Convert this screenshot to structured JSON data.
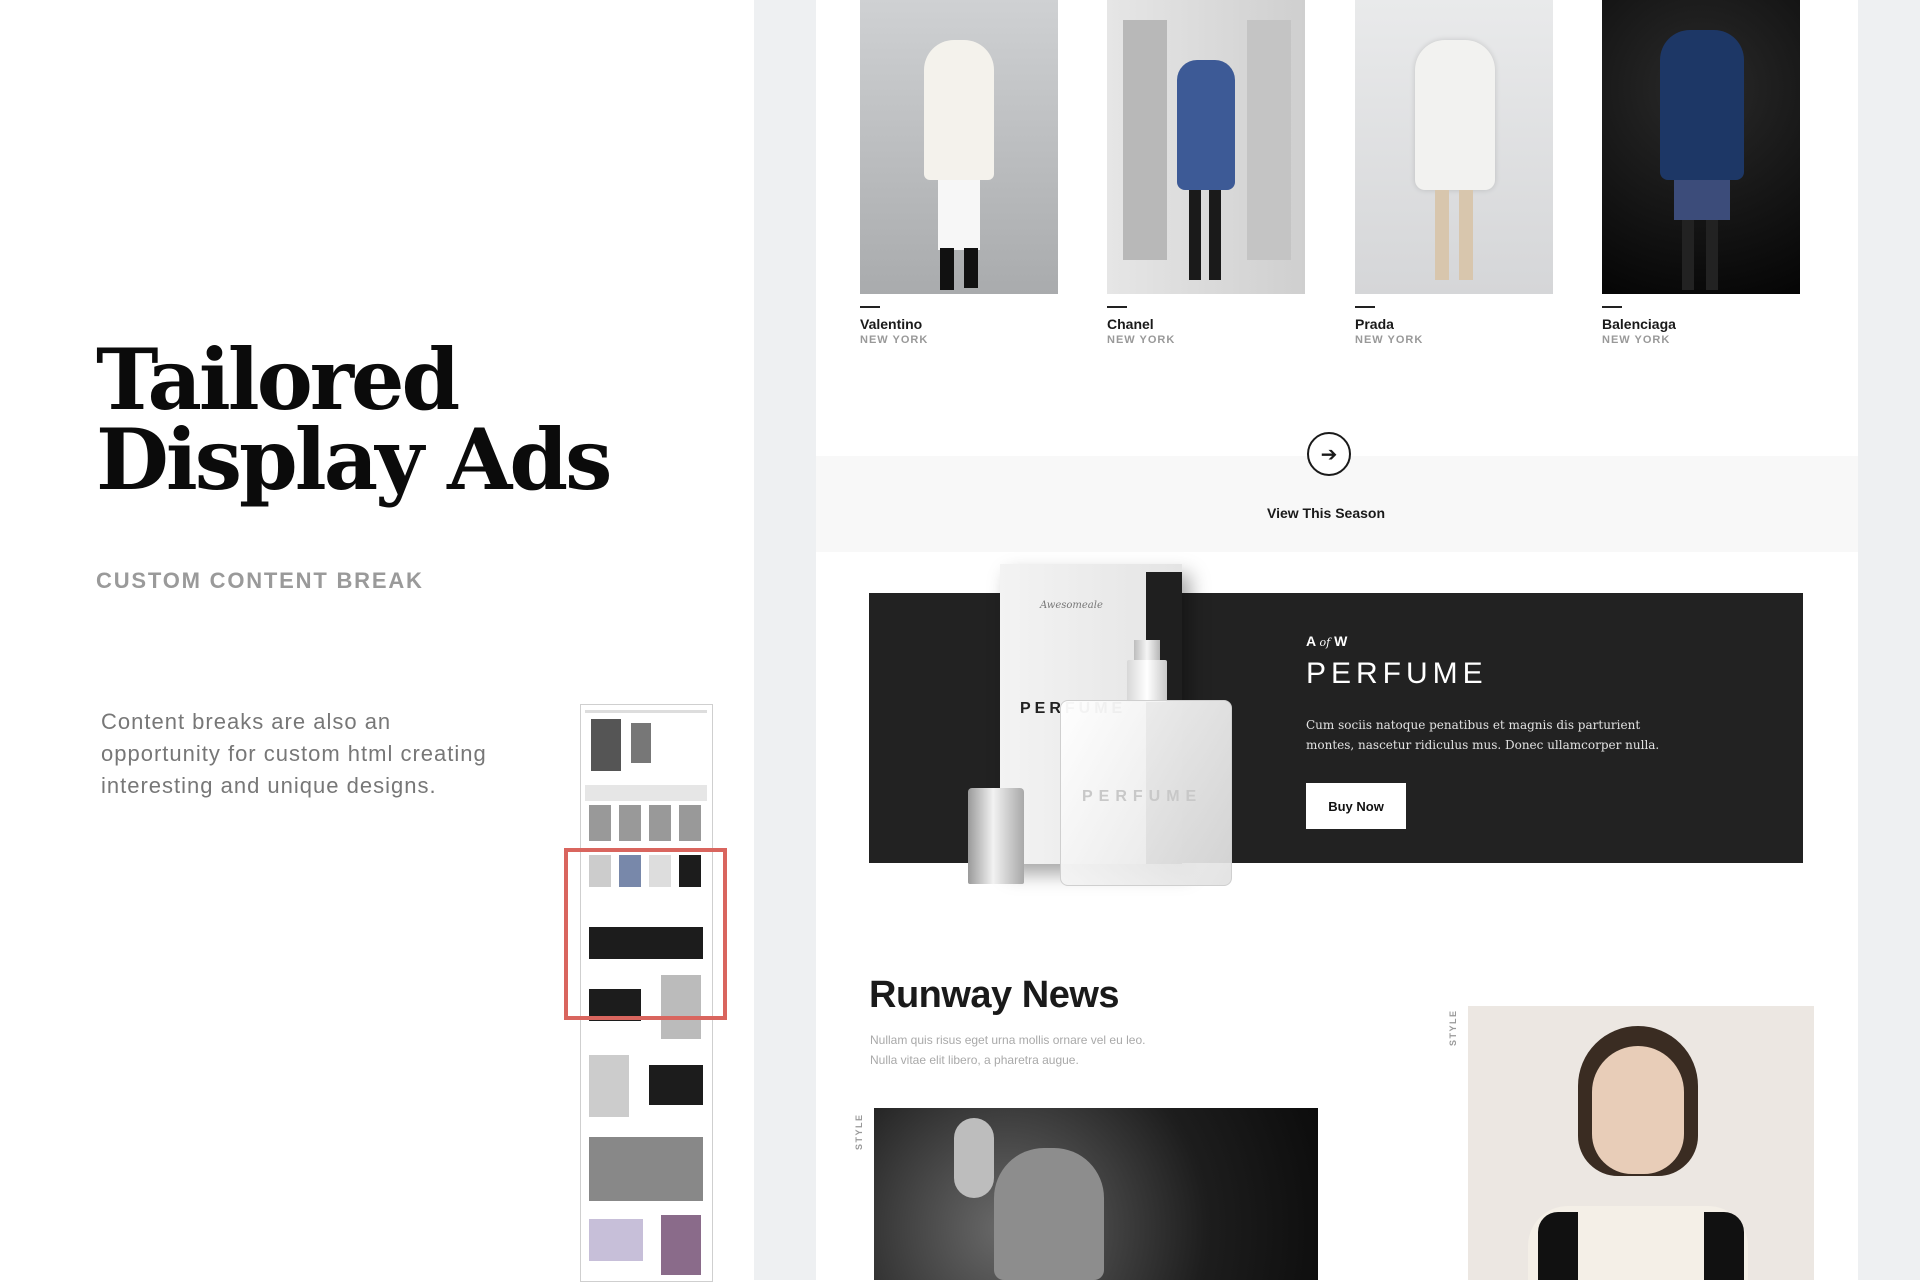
{
  "left": {
    "headline_line1": "Tailored",
    "headline_line2": "Display Ads",
    "subtitle": "CUSTOM CONTENT BREAK",
    "description": "Content breaks are also an opportunity for custom html creating interesting and unique designs."
  },
  "designers": [
    {
      "name": "Valentino",
      "city": "NEW YORK"
    },
    {
      "name": "Chanel",
      "city": "NEW YORK"
    },
    {
      "name": "Prada",
      "city": "NEW YORK"
    },
    {
      "name": "Balenciaga",
      "city": "NEW YORK"
    }
  ],
  "season": {
    "label": "View This Season",
    "icon": "arrow-right-icon"
  },
  "ad": {
    "box_logo": "Awesomeale",
    "box_text": "PERFUME",
    "bottle_text": "PERFUME",
    "brand_a": "A",
    "brand_of": "of",
    "brand_w": "W",
    "title": "PERFUME",
    "body": "Cum sociis natoque penatibus et magnis dis parturient montes, nascetur ridiculus mus. Donec ullamcorper nulla.",
    "button": "Buy Now"
  },
  "news": {
    "title": "Runway News",
    "body": "Nullam quis risus eget urna mollis ornare vel eu leo. Nulla vitae elit libero, a pharetra augue.",
    "tag": "STYLE"
  },
  "colors": {
    "highlight": "#d9655e",
    "ad_bg": "#222222",
    "preview_bg": "#eef0f2"
  }
}
